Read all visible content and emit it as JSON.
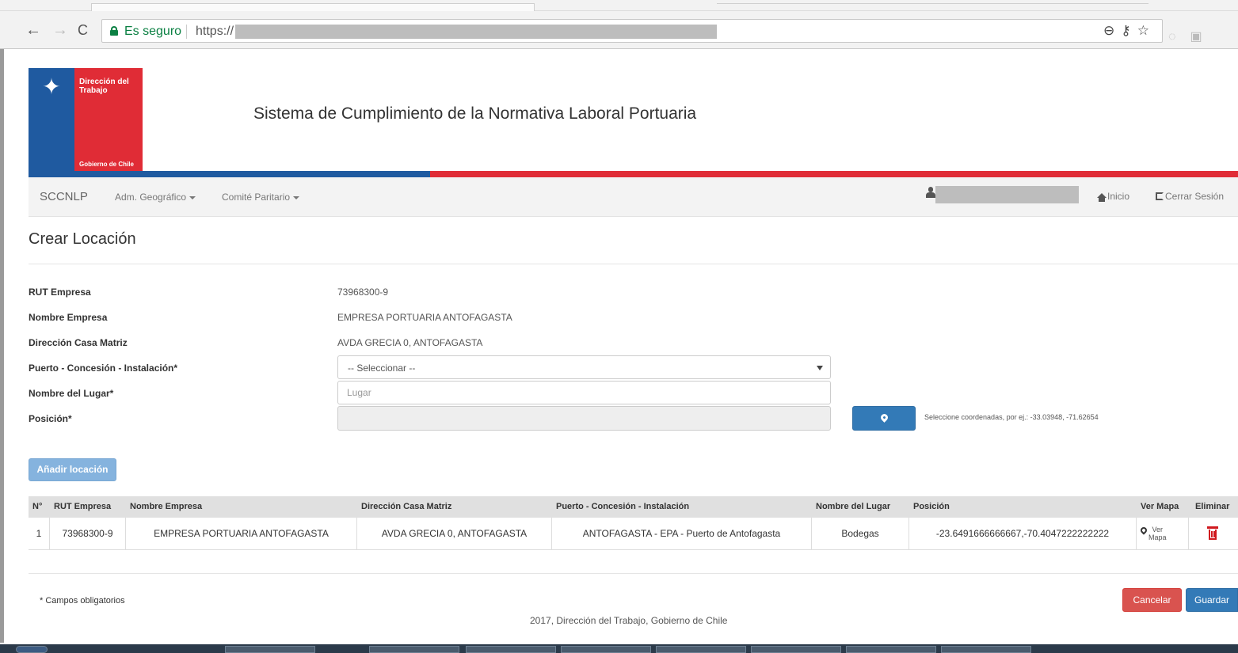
{
  "browser": {
    "secure_label": "Es seguro",
    "url_prefix": "https://"
  },
  "header": {
    "logo_line1": "Dirección del Trabajo",
    "logo_line2": "Gobierno de Chile",
    "app_title": "Sistema de Cumplimiento de la Normativa Laboral Portuaria"
  },
  "navbar": {
    "brand": "SCCNLP",
    "items": [
      {
        "label": "Adm. Geográfico"
      },
      {
        "label": "Comité Paritario"
      }
    ],
    "home_label": "Inicio",
    "logout_label": "Cerrar Sesión"
  },
  "page": {
    "title": "Crear Locación"
  },
  "form": {
    "rut_label": "RUT Empresa",
    "rut_value": "73968300-9",
    "nombre_label": "Nombre Empresa",
    "nombre_value": "EMPRESA PORTUARIA ANTOFAGASTA",
    "direccion_label": "Dirección Casa Matriz",
    "direccion_value": "AVDA GRECIA 0, ANTOFAGASTA",
    "puerto_label": "Puerto - Concesión - Instalación*",
    "puerto_selected": "-- Seleccionar --",
    "lugar_label": "Nombre del Lugar*",
    "lugar_placeholder": "Lugar",
    "lugar_value": "",
    "posicion_label": "Posición*",
    "posicion_value": "",
    "coord_help": "Seleccione coordenadas, por ej.: -33.03948, -71.62654",
    "add_button": "Añadir locación"
  },
  "table": {
    "headers": [
      "N°",
      "RUT Empresa",
      "Nombre Empresa",
      "Dirección Casa Matriz",
      "Puerto - Concesión - Instalación",
      "Nombre del Lugar",
      "Posición",
      "Ver Mapa",
      "Eliminar"
    ],
    "rows": [
      {
        "n": "1",
        "rut": "73968300-9",
        "nombre": "EMPRESA PORTUARIA ANTOFAGASTA",
        "direccion": "AVDA GRECIA 0, ANTOFAGASTA",
        "puerto": "ANTOFAGASTA - EPA - Puerto de Antofagasta",
        "lugar": "Bodegas",
        "posicion": "-23.6491666666667,-70.4047222222222",
        "ver_mapa_line1": "Ver",
        "ver_mapa_line2": "Mapa"
      }
    ]
  },
  "footer": {
    "required_note": "* Campos obligatorios",
    "cancel": "Cancelar",
    "save": "Guardar",
    "copyright": "2017, Dirección del Trabajo, Gobierno de Chile"
  },
  "colors": {
    "primary": "#337ab7",
    "danger": "#d9534f",
    "brand_blue": "#1f5aa0",
    "brand_red": "#e02c36"
  },
  "icons": [
    "back-icon",
    "forward-icon",
    "reload-icon",
    "lock-icon",
    "zoom-icon",
    "key-icon",
    "star-icon",
    "user-icon",
    "home-icon",
    "logout-icon",
    "map-marker-icon",
    "trash-icon"
  ]
}
